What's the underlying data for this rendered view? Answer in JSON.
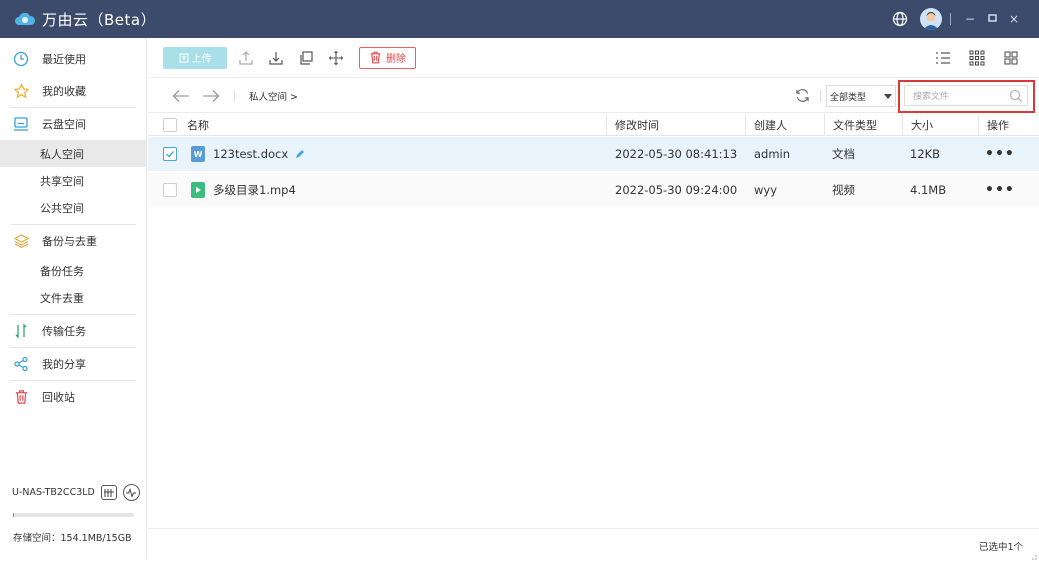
{
  "app": {
    "title": "万由云（Beta）"
  },
  "sidebar": {
    "recent": "最近使用",
    "favorites": "我的收藏",
    "cloud": "云盘空间",
    "cloud_subs": [
      "私人空间",
      "共享空间",
      "公共空间"
    ],
    "backup": "备份与去重",
    "backup_subs": [
      "备份任务",
      "文件去重"
    ],
    "transfer": "传输任务",
    "share": "我的分享",
    "trash": "回收站",
    "device_name": "U-NAS-TB2CC3LD",
    "storage_label": "存储空间：154.1MB/15GB",
    "storage_fraction": 0.01
  },
  "toolbar": {
    "upload_label": "上传",
    "delete_label": "删除"
  },
  "navbar": {
    "breadcrumb": "私人空间 >",
    "type_filter": "全部类型",
    "search_placeholder": "搜索文件"
  },
  "table": {
    "headers": {
      "name": "名称",
      "modified": "修改时间",
      "creator": "创建人",
      "type": "文件类型",
      "size": "大小",
      "actions": "操作"
    },
    "rows": [
      {
        "name": "123test.docx",
        "modified": "2022-05-30 08:41:13",
        "creator": "admin",
        "type": "文档",
        "size": "12KB",
        "more": "•••",
        "selected": true,
        "icon": "word-doc-icon",
        "icon_color": "#5b9bd5"
      },
      {
        "name": "多级目录1.mp4",
        "modified": "2022-05-30 09:24:00",
        "creator": "wyy",
        "type": "视频",
        "size": "4.1MB",
        "more": "•••",
        "selected": false,
        "icon": "video-file-icon",
        "icon_color": "#3dbd7d"
      }
    ]
  },
  "status": {
    "selected_text": "已选中1个"
  },
  "colors": {
    "titlebar": "#3c4a6b",
    "accent": "#4aa3d6",
    "danger": "#e5484d",
    "selection": "#e8f3fb"
  }
}
